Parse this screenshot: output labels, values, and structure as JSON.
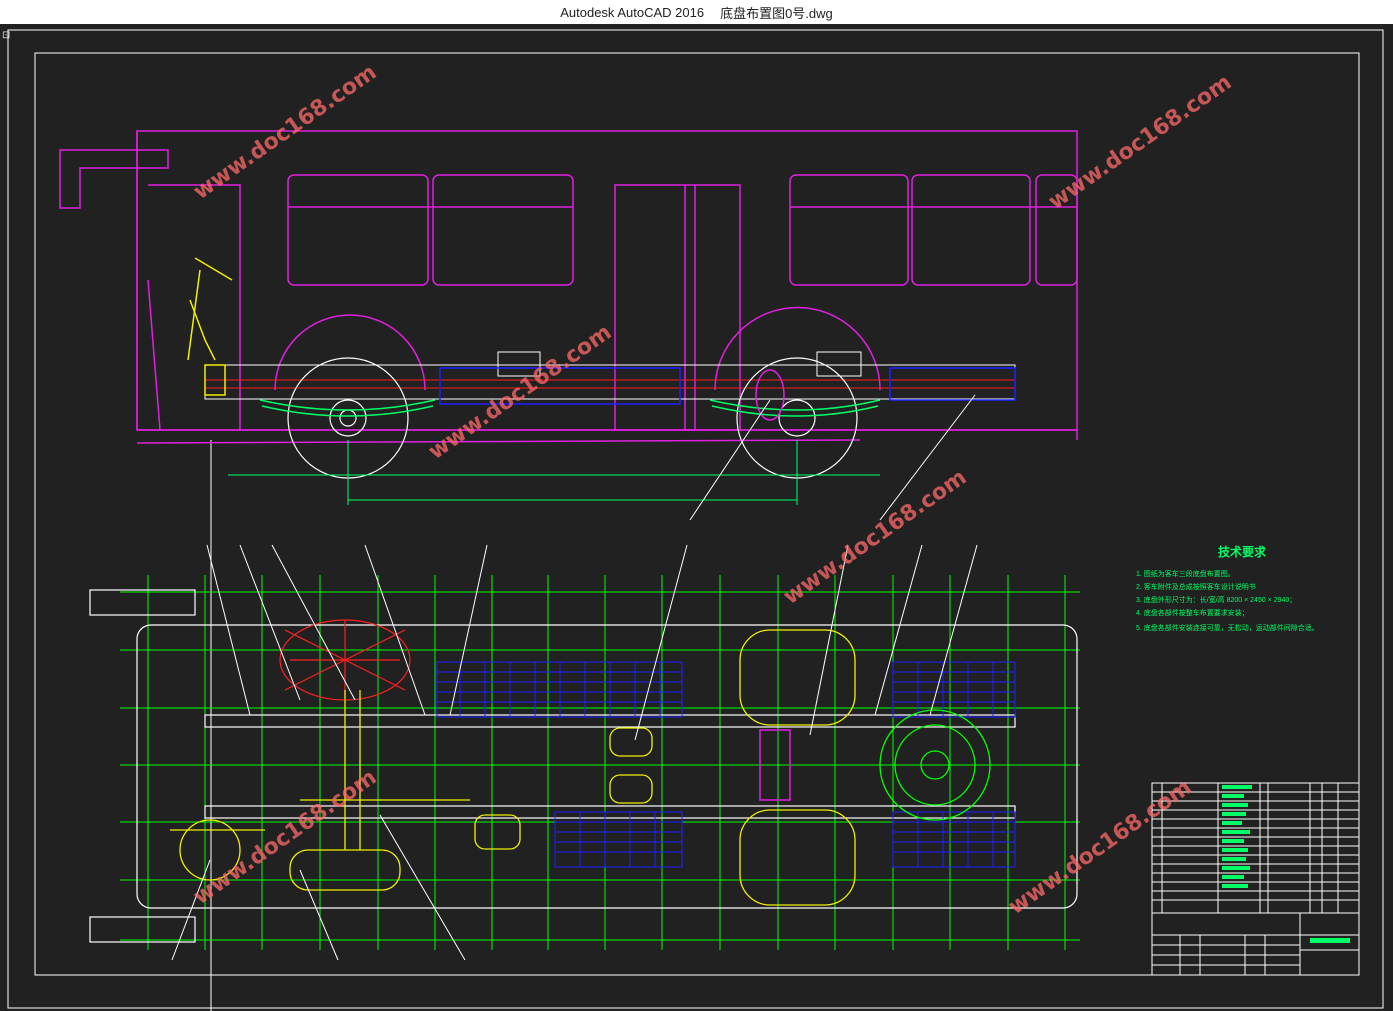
{
  "window": {
    "app_name": "Autodesk AutoCAD 2016",
    "file_name": "底盘布置图0号.dwg"
  },
  "drawing": {
    "tech_requirements": {
      "title": "技术要求",
      "lines": [
        "1. 图纸为客车三段底盘布置图。",
        "2. 客车附件及总成按照客车设计说明书",
        "3. 底盘外形尺寸为：长/宽/高 8200 × 2450 × 2940；",
        "4. 底盘各部件按整车布置要求安装；",
        "5. 底盘各部件安装连接可靠，无松动，运动部件间隙合适。"
      ]
    },
    "watermark_text": "www.doc168.com",
    "colors": {
      "body": "#e020e0",
      "frame": "#ffffff",
      "chassis": "#f0f000",
      "grid": "#00ff00",
      "blue": "#2020ff",
      "red": "#ff2020",
      "cyan": "#00e0e0"
    }
  }
}
